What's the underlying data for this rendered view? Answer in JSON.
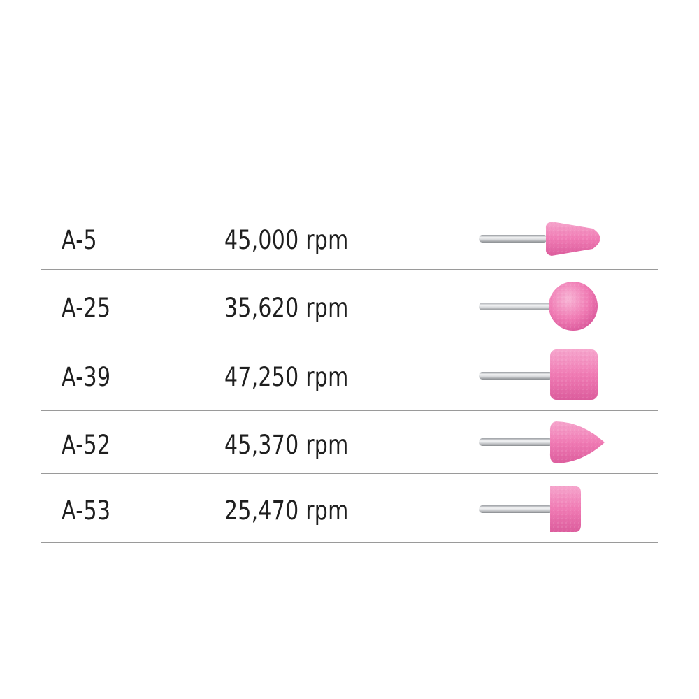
{
  "rows": [
    {
      "model": "A-5",
      "speed": "45,000 rpm",
      "shape": "cone-stone-icon"
    },
    {
      "model": "A-25",
      "speed": "35,620 rpm",
      "shape": "ball-stone-icon"
    },
    {
      "model": "A-39",
      "speed": "47,250 rpm",
      "shape": "cylinder-stone-icon"
    },
    {
      "model": "A-52",
      "speed": "45,370 rpm",
      "shape": "bullet-stone-icon"
    },
    {
      "model": "A-53",
      "speed": "25,470 rpm",
      "shape": "short-cylinder-stone-icon"
    }
  ],
  "colors": {
    "stone": "#f07bb4",
    "stone_dark": "#dd5a9c",
    "stone_light": "#f9b3d6",
    "shaft": "#c9cbcd",
    "divider": "#9a9a9a",
    "text": "#1f1f1f"
  }
}
